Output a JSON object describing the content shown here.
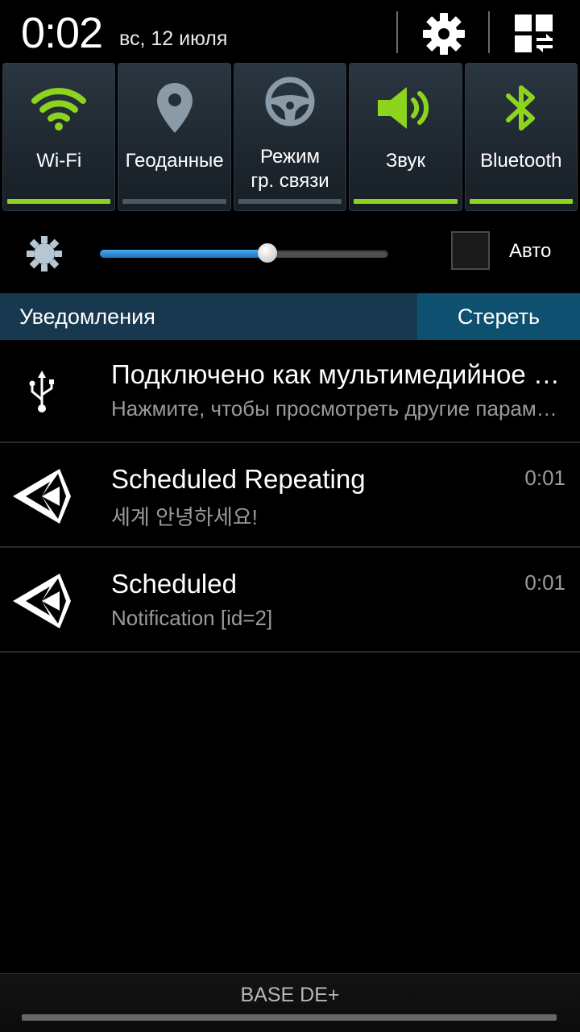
{
  "status": {
    "time": "0:02",
    "date": "вс, 12 июля"
  },
  "header_icons": {
    "settings": "gear-icon",
    "edit": "grid-swap-icon"
  },
  "toggles": [
    {
      "label": "Wi-Fi",
      "icon": "wifi-icon",
      "on": true
    },
    {
      "label": "Геоданные",
      "icon": "location-icon",
      "on": false
    },
    {
      "label_line1": "Режим",
      "label_line2": "гр. связи",
      "icon": "steering-wheel-icon",
      "on": false
    },
    {
      "label": "Звук",
      "icon": "speaker-icon",
      "on": true
    },
    {
      "label": "Bluetooth",
      "icon": "bluetooth-icon",
      "on": true
    }
  ],
  "brightness": {
    "level": 0.58,
    "auto_label": "Авто",
    "auto_checked": false
  },
  "notifications_panel": {
    "title": "Уведомления",
    "clear_label": "Стереть"
  },
  "notifications": [
    {
      "icon": "usb-icon",
      "title": "Подключено как мультимедийное устройство",
      "text": "Нажмите, чтобы просмотреть другие параметры USB",
      "time": ""
    },
    {
      "icon": "unity-icon",
      "title": "Scheduled Repeating",
      "text": "세계 안녕하세요!",
      "time": "0:01"
    },
    {
      "icon": "unity-icon",
      "title": "Scheduled",
      "text": "Notification [id=2]",
      "time": "0:01"
    }
  ],
  "footer": {
    "carrier": "BASE DE+"
  },
  "colors": {
    "accent_green": "#8cd41e",
    "slider_blue": "#1c74c4",
    "notif_header": "#17384e",
    "clear_button": "#0e506f"
  }
}
